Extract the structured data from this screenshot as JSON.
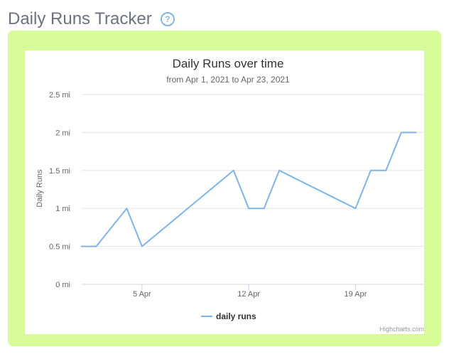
{
  "header": {
    "title": "Daily Runs Tracker",
    "help_icon": "question-circle-icon"
  },
  "colors": {
    "panel_background": "#d6fb98",
    "series_line": "#7cb5ec",
    "title_text": "#333333",
    "muted_text": "#666666"
  },
  "chart_data": {
    "type": "line",
    "title": "Daily Runs over time",
    "subtitle": "from Apr 1, 2021 to Apr 23, 2021",
    "ylabel": "Daily Runs",
    "xlabel": "",
    "ylim": [
      0,
      2.5
    ],
    "y_ticks": [
      {
        "value": 0,
        "label": "0 mi"
      },
      {
        "value": 0.5,
        "label": "0.5 mi"
      },
      {
        "value": 1,
        "label": "1 mi"
      },
      {
        "value": 1.5,
        "label": "1.5 mi"
      },
      {
        "value": 2,
        "label": "2 mi"
      },
      {
        "value": 2.5,
        "label": "2.5 mi"
      }
    ],
    "x_ticks": [
      {
        "value": "2021-04-05",
        "label": "5 Apr"
      },
      {
        "value": "2021-04-12",
        "label": "12 Apr"
      },
      {
        "value": "2021-04-19",
        "label": "19 Apr"
      }
    ],
    "grid": true,
    "legend_position": "bottom-center",
    "series": [
      {
        "name": "daily runs",
        "x": [
          "2021-04-01",
          "2021-04-02",
          "2021-04-03",
          "2021-04-04",
          "2021-04-05",
          "2021-04-11",
          "2021-04-12",
          "2021-04-13",
          "2021-04-14",
          "2021-04-19",
          "2021-04-20",
          "2021-04-21",
          "2021-04-22",
          "2021-04-23"
        ],
        "values": [
          0.5,
          0.5,
          0.75,
          1.0,
          0.5,
          1.5,
          1.0,
          1.0,
          1.5,
          1.0,
          1.5,
          1.5,
          2.0,
          2.0
        ]
      }
    ],
    "credits": "Highcharts.com"
  }
}
